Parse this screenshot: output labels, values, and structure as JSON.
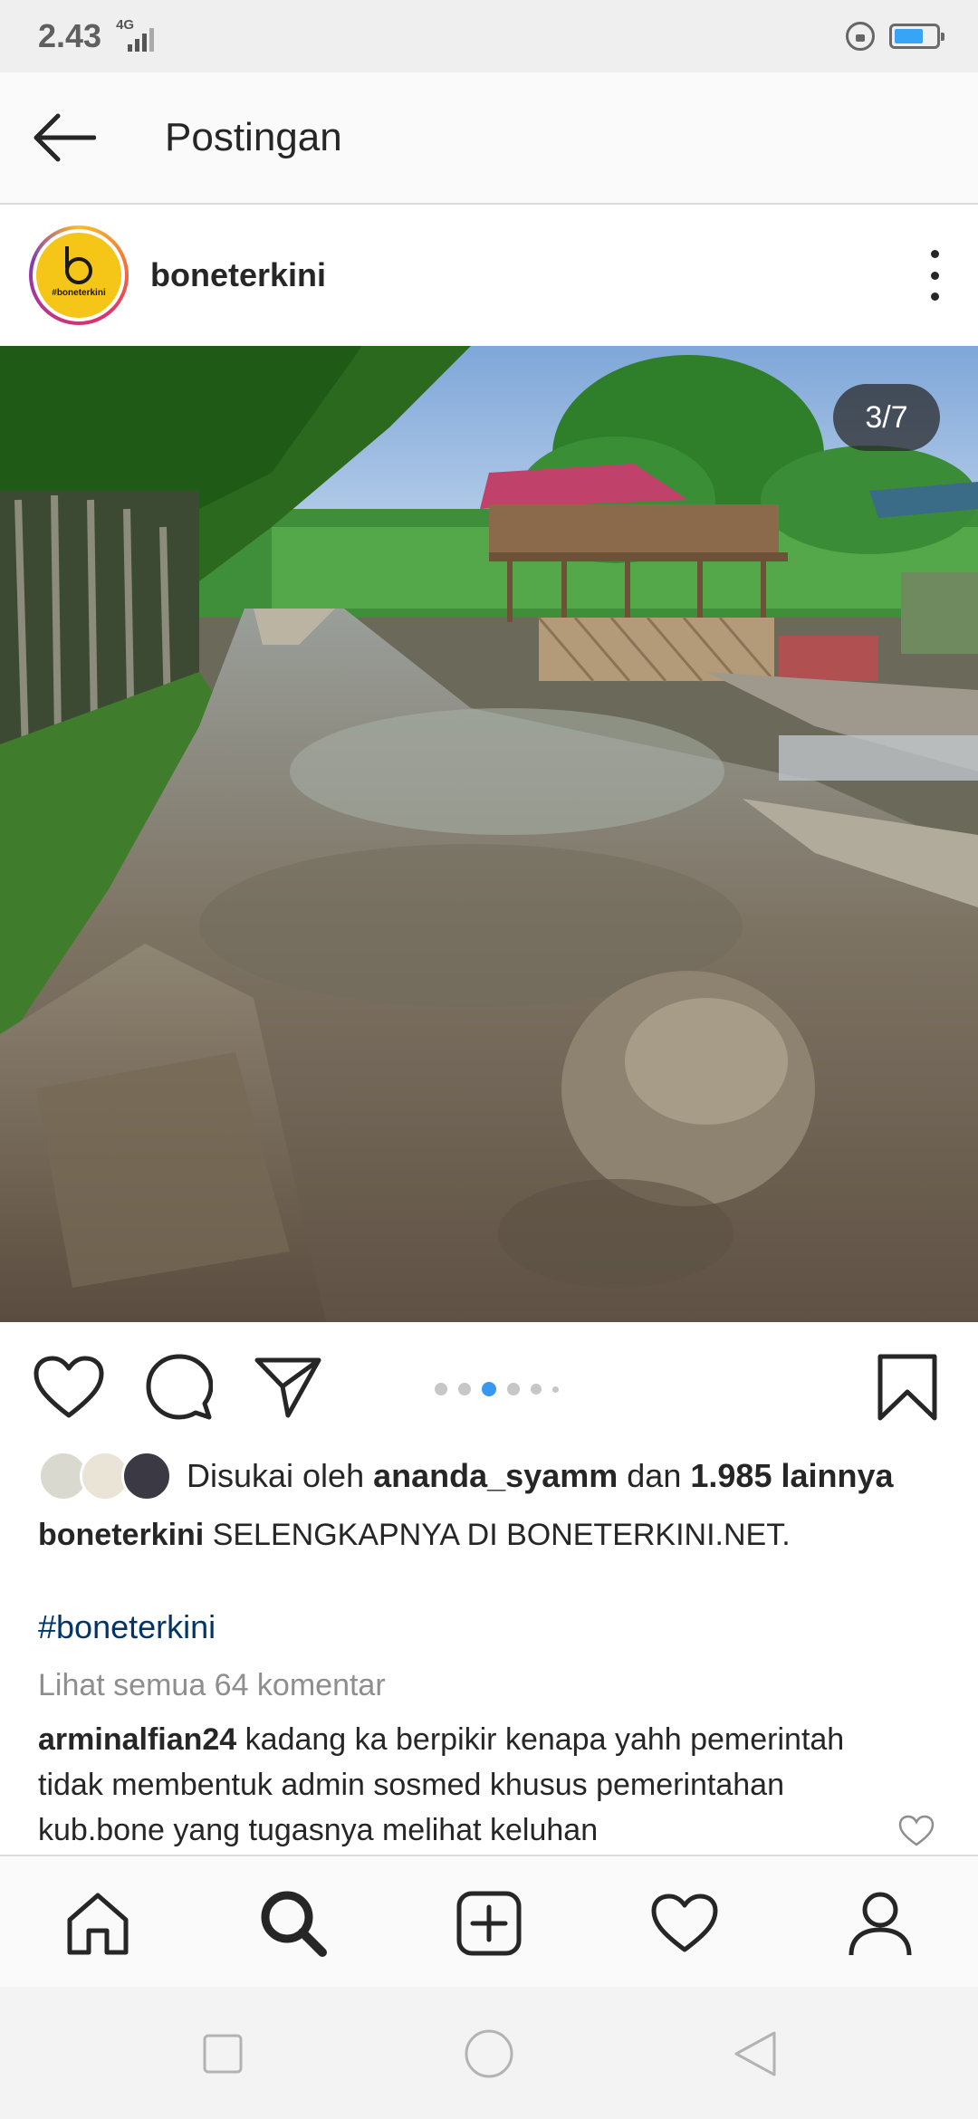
{
  "status_bar": {
    "time": "2.43",
    "network": "4G",
    "battery_level": 0.7
  },
  "app_bar": {
    "title": "Postingan"
  },
  "post": {
    "username": "boneterkini",
    "avatar_text": "#boneterkini",
    "counter": "3/7",
    "current_slide": 3,
    "total_slides": 7
  },
  "likes": {
    "prefix": "Disukai oleh",
    "user": "ananda_syamm",
    "conj": "dan",
    "others": "1.985 lainnya"
  },
  "caption": {
    "user": "boneterkini",
    "text": "SELENGKAPNYA DI BONETERKINI.NET.",
    "hashtag": "#boneterkini"
  },
  "comments": {
    "view_all": "Lihat semua 64 komentar",
    "first": {
      "user": "arminalfian24",
      "text": "kadang ka berpikir kenapa yahh pemerintah tidak membentuk admin sosmed khusus pemerintahan kub.bone yang tugasnya melihat keluhan"
    }
  },
  "icons": {
    "back": "arrow-left-icon",
    "more": "more-vertical-icon",
    "like": "heart-icon",
    "comment": "comment-icon",
    "share": "send-icon",
    "save": "bookmark-icon",
    "home": "home-icon",
    "search": "search-icon",
    "add": "add-post-icon",
    "activity": "heart-icon",
    "profile": "profile-icon"
  },
  "colors": {
    "link": "#003569",
    "active_dot": "#3897f0",
    "muted": "#8e8e8e"
  }
}
